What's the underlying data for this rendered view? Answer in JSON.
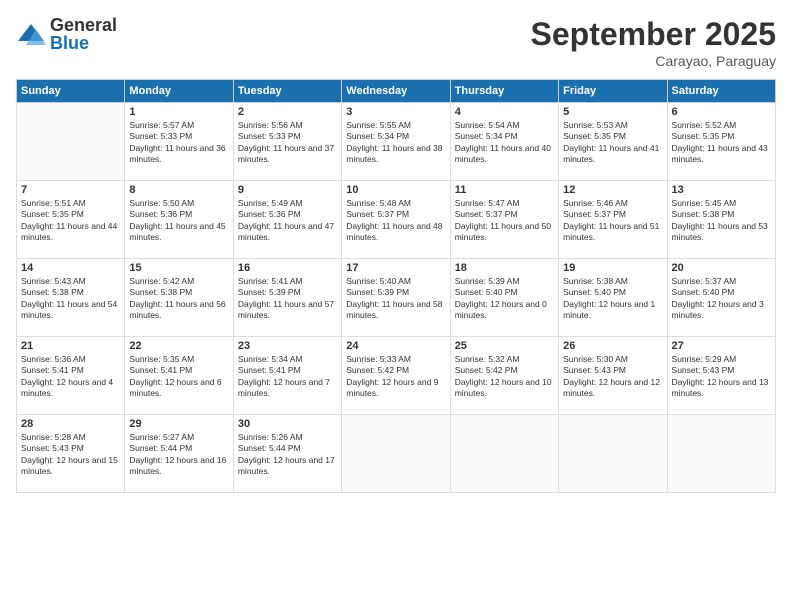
{
  "logo": {
    "general": "General",
    "blue": "Blue"
  },
  "title": "September 2025",
  "location": "Carayao, Paraguay",
  "days_of_week": [
    "Sunday",
    "Monday",
    "Tuesday",
    "Wednesday",
    "Thursday",
    "Friday",
    "Saturday"
  ],
  "weeks": [
    [
      {
        "num": "",
        "empty": true
      },
      {
        "num": "1",
        "sunrise": "Sunrise: 5:57 AM",
        "sunset": "Sunset: 5:33 PM",
        "daylight": "Daylight: 11 hours and 36 minutes."
      },
      {
        "num": "2",
        "sunrise": "Sunrise: 5:56 AM",
        "sunset": "Sunset: 5:33 PM",
        "daylight": "Daylight: 11 hours and 37 minutes."
      },
      {
        "num": "3",
        "sunrise": "Sunrise: 5:55 AM",
        "sunset": "Sunset: 5:34 PM",
        "daylight": "Daylight: 11 hours and 38 minutes."
      },
      {
        "num": "4",
        "sunrise": "Sunrise: 5:54 AM",
        "sunset": "Sunset: 5:34 PM",
        "daylight": "Daylight: 11 hours and 40 minutes."
      },
      {
        "num": "5",
        "sunrise": "Sunrise: 5:53 AM",
        "sunset": "Sunset: 5:35 PM",
        "daylight": "Daylight: 11 hours and 41 minutes."
      },
      {
        "num": "6",
        "sunrise": "Sunrise: 5:52 AM",
        "sunset": "Sunset: 5:35 PM",
        "daylight": "Daylight: 11 hours and 43 minutes."
      }
    ],
    [
      {
        "num": "7",
        "sunrise": "Sunrise: 5:51 AM",
        "sunset": "Sunset: 5:35 PM",
        "daylight": "Daylight: 11 hours and 44 minutes."
      },
      {
        "num": "8",
        "sunrise": "Sunrise: 5:50 AM",
        "sunset": "Sunset: 5:36 PM",
        "daylight": "Daylight: 11 hours and 45 minutes."
      },
      {
        "num": "9",
        "sunrise": "Sunrise: 5:49 AM",
        "sunset": "Sunset: 5:36 PM",
        "daylight": "Daylight: 11 hours and 47 minutes."
      },
      {
        "num": "10",
        "sunrise": "Sunrise: 5:48 AM",
        "sunset": "Sunset: 5:37 PM",
        "daylight": "Daylight: 11 hours and 48 minutes."
      },
      {
        "num": "11",
        "sunrise": "Sunrise: 5:47 AM",
        "sunset": "Sunset: 5:37 PM",
        "daylight": "Daylight: 11 hours and 50 minutes."
      },
      {
        "num": "12",
        "sunrise": "Sunrise: 5:46 AM",
        "sunset": "Sunset: 5:37 PM",
        "daylight": "Daylight: 11 hours and 51 minutes."
      },
      {
        "num": "13",
        "sunrise": "Sunrise: 5:45 AM",
        "sunset": "Sunset: 5:38 PM",
        "daylight": "Daylight: 11 hours and 53 minutes."
      }
    ],
    [
      {
        "num": "14",
        "sunrise": "Sunrise: 5:43 AM",
        "sunset": "Sunset: 5:38 PM",
        "daylight": "Daylight: 11 hours and 54 minutes."
      },
      {
        "num": "15",
        "sunrise": "Sunrise: 5:42 AM",
        "sunset": "Sunset: 5:38 PM",
        "daylight": "Daylight: 11 hours and 56 minutes."
      },
      {
        "num": "16",
        "sunrise": "Sunrise: 5:41 AM",
        "sunset": "Sunset: 5:39 PM",
        "daylight": "Daylight: 11 hours and 57 minutes."
      },
      {
        "num": "17",
        "sunrise": "Sunrise: 5:40 AM",
        "sunset": "Sunset: 5:39 PM",
        "daylight": "Daylight: 11 hours and 58 minutes."
      },
      {
        "num": "18",
        "sunrise": "Sunrise: 5:39 AM",
        "sunset": "Sunset: 5:40 PM",
        "daylight": "Daylight: 12 hours and 0 minutes."
      },
      {
        "num": "19",
        "sunrise": "Sunrise: 5:38 AM",
        "sunset": "Sunset: 5:40 PM",
        "daylight": "Daylight: 12 hours and 1 minute."
      },
      {
        "num": "20",
        "sunrise": "Sunrise: 5:37 AM",
        "sunset": "Sunset: 5:40 PM",
        "daylight": "Daylight: 12 hours and 3 minutes."
      }
    ],
    [
      {
        "num": "21",
        "sunrise": "Sunrise: 5:36 AM",
        "sunset": "Sunset: 5:41 PM",
        "daylight": "Daylight: 12 hours and 4 minutes."
      },
      {
        "num": "22",
        "sunrise": "Sunrise: 5:35 AM",
        "sunset": "Sunset: 5:41 PM",
        "daylight": "Daylight: 12 hours and 6 minutes."
      },
      {
        "num": "23",
        "sunrise": "Sunrise: 5:34 AM",
        "sunset": "Sunset: 5:41 PM",
        "daylight": "Daylight: 12 hours and 7 minutes."
      },
      {
        "num": "24",
        "sunrise": "Sunrise: 5:33 AM",
        "sunset": "Sunset: 5:42 PM",
        "daylight": "Daylight: 12 hours and 9 minutes."
      },
      {
        "num": "25",
        "sunrise": "Sunrise: 5:32 AM",
        "sunset": "Sunset: 5:42 PM",
        "daylight": "Daylight: 12 hours and 10 minutes."
      },
      {
        "num": "26",
        "sunrise": "Sunrise: 5:30 AM",
        "sunset": "Sunset: 5:43 PM",
        "daylight": "Daylight: 12 hours and 12 minutes."
      },
      {
        "num": "27",
        "sunrise": "Sunrise: 5:29 AM",
        "sunset": "Sunset: 5:43 PM",
        "daylight": "Daylight: 12 hours and 13 minutes."
      }
    ],
    [
      {
        "num": "28",
        "sunrise": "Sunrise: 5:28 AM",
        "sunset": "Sunset: 5:43 PM",
        "daylight": "Daylight: 12 hours and 15 minutes."
      },
      {
        "num": "29",
        "sunrise": "Sunrise: 5:27 AM",
        "sunset": "Sunset: 5:44 PM",
        "daylight": "Daylight: 12 hours and 16 minutes."
      },
      {
        "num": "30",
        "sunrise": "Sunrise: 5:26 AM",
        "sunset": "Sunset: 5:44 PM",
        "daylight": "Daylight: 12 hours and 17 minutes."
      },
      {
        "num": "",
        "empty": true
      },
      {
        "num": "",
        "empty": true
      },
      {
        "num": "",
        "empty": true
      },
      {
        "num": "",
        "empty": true
      }
    ]
  ]
}
